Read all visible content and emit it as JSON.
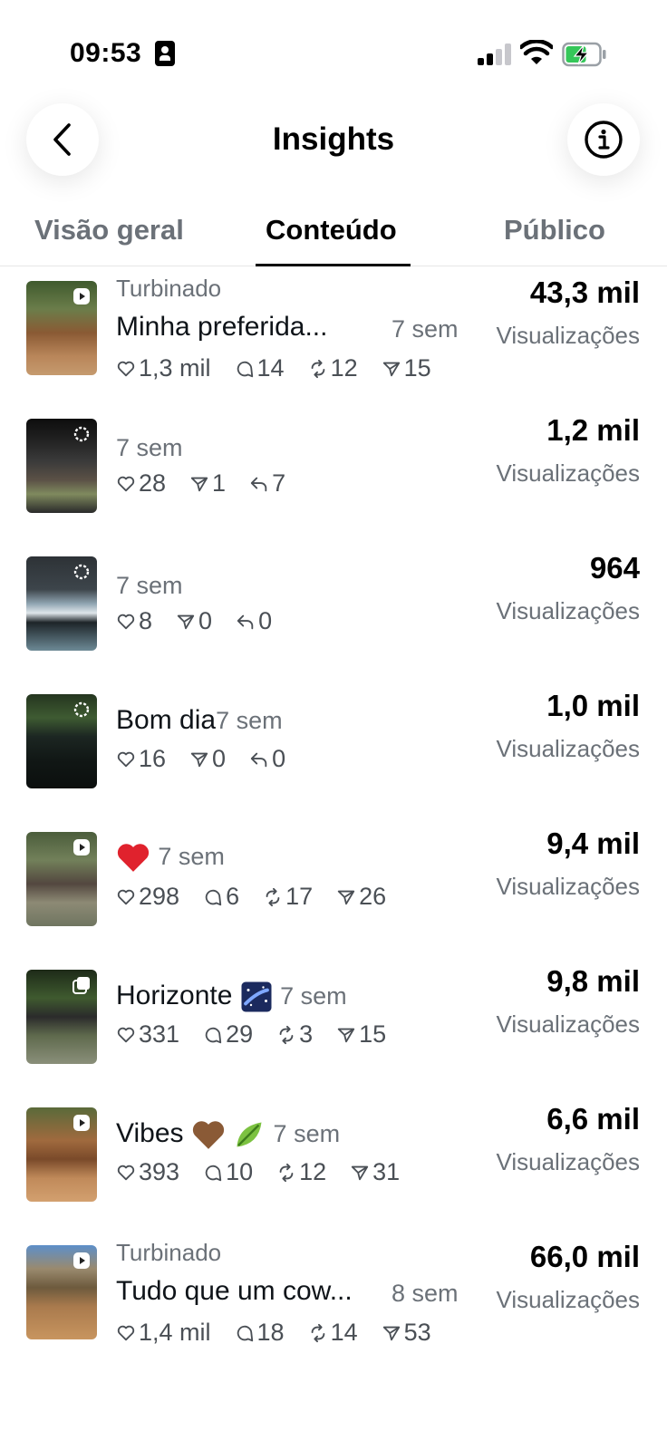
{
  "status_bar": {
    "time": "09:53"
  },
  "header": {
    "title": "Insights"
  },
  "tabs": [
    {
      "label": "Visão geral",
      "active": false
    },
    {
      "label": "Conteúdo",
      "active": true
    },
    {
      "label": "Público",
      "active": false
    }
  ],
  "posts": [
    {
      "label": "Turbinado",
      "caption": "Minha preferida...",
      "age": "7 sem",
      "stats": [
        "1,3 mil",
        "14",
        "12",
        "15"
      ],
      "value": "43,3 mil",
      "metric": "Visualizações"
    },
    {
      "label": "",
      "caption": "",
      "age": "7 sem",
      "stats": [
        "28",
        "1",
        "7"
      ],
      "value": "1,2 mil",
      "metric": "Visualizações"
    },
    {
      "label": "",
      "caption": "",
      "age": "7 sem",
      "stats": [
        "8",
        "0",
        "0"
      ],
      "value": "964",
      "metric": "Visualizações"
    },
    {
      "label": "",
      "caption": "Bom dia",
      "age": "7 sem",
      "stats": [
        "16",
        "0",
        "0"
      ],
      "value": "1,0 mil",
      "metric": "Visualizações"
    },
    {
      "label": "",
      "caption": "",
      "age": "7 sem",
      "stats": [
        "298",
        "6",
        "17",
        "26"
      ],
      "value": "9,4 mil",
      "metric": "Visualizações"
    },
    {
      "label": "",
      "caption": "Horizonte",
      "age": "7 sem",
      "stats": [
        "331",
        "29",
        "3",
        "15"
      ],
      "value": "9,8 mil",
      "metric": "Visualizações"
    },
    {
      "label": "",
      "caption": "Vibes",
      "age": "7 sem",
      "stats": [
        "393",
        "10",
        "12",
        "31"
      ],
      "value": "6,6 mil",
      "metric": "Visualizações"
    },
    {
      "label": "Turbinado",
      "caption": "Tudo que um cow...",
      "age": "8 sem",
      "stats": [
        "1,4 mil",
        "18",
        "14",
        "53"
      ],
      "value": "66,0 mil",
      "metric": "Visualizações"
    }
  ],
  "colors": {
    "text": "#0f1419",
    "secondary": "#6b7178",
    "divider": "#e6e6e6"
  }
}
